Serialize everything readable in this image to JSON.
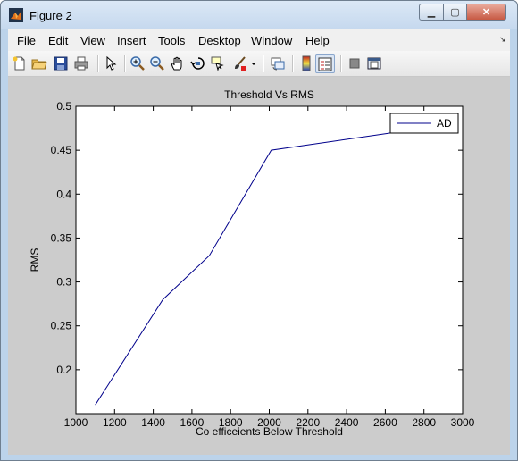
{
  "window": {
    "title": "Figure 2"
  },
  "menu": [
    "File",
    "Edit",
    "View",
    "Insert",
    "Tools",
    "Desktop",
    "Window",
    "Help"
  ],
  "menu_underline": [
    "F",
    "E",
    "V",
    "I",
    "T",
    "D",
    "W",
    "H"
  ],
  "toolbar_icons": [
    "new-figure-icon",
    "open-file-icon",
    "save-icon",
    "print-icon",
    "edit-plot-arrow-icon",
    "zoom-in-icon",
    "zoom-out-icon",
    "pan-hand-icon",
    "rotate-3d-icon",
    "data-cursor-icon",
    "brush-icon",
    "brush-dropdown-icon",
    "link-plot-icon",
    "colorbar-icon",
    "legend-icon",
    "hide-plot-tools-icon",
    "show-plot-tools-icon"
  ],
  "colors": {
    "line": "#00008b",
    "figure_bg": "#cccccc",
    "axes_bg": "#ffffff"
  },
  "chart_data": {
    "type": "line",
    "title": "Threshold Vs RMS",
    "xlabel": "Co efficeients Below Threshold",
    "ylabel": "RMS",
    "xlim": [
      1000,
      3000
    ],
    "ylim": [
      0.15,
      0.5
    ],
    "xticks": [
      "1000",
      "1200",
      "1400",
      "1600",
      "1800",
      "2000",
      "2200",
      "2400",
      "2600",
      "2800",
      "3000"
    ],
    "yticks": [
      "0.2",
      "0.25",
      "0.3",
      "0.35",
      "0.4",
      "0.45",
      "0.5"
    ],
    "grid": false,
    "legend": "top-right",
    "series": [
      {
        "name": "AD",
        "x": [
          1100,
          1450,
          1690,
          2010,
          2640
        ],
        "y": [
          0.16,
          0.28,
          0.33,
          0.45,
          0.47
        ]
      }
    ]
  }
}
